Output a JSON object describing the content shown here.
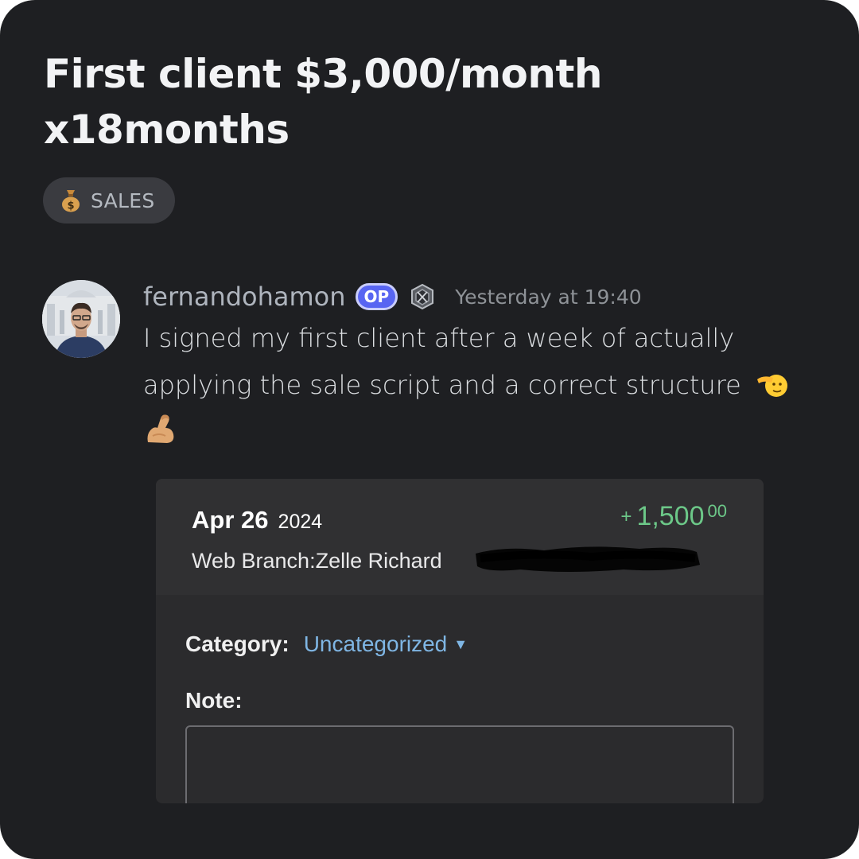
{
  "post": {
    "title": "First client $3,000/month x18months",
    "tag": {
      "icon": "money-bag-icon",
      "label": "SALES"
    }
  },
  "message": {
    "author": "fernandohamon",
    "op_badge": "OP",
    "rank_icon": "shield-rank-icon",
    "timestamp": "Yesterday at 19:40",
    "text": "I signed my first client after a week of actually applying the sale script and a correct structure",
    "emojis": [
      "saluting-face-icon",
      "flexed-biceps-icon"
    ]
  },
  "attachment": {
    "date_main": "Apr 26",
    "date_year": "2024",
    "amount_sign": "+",
    "amount_main": "1,500",
    "amount_cents": "00",
    "description": "Web Branch:Zelle Richard",
    "category_label": "Category:",
    "category_value": "Uncategorized",
    "note_label": "Note:",
    "note_value": ""
  },
  "colors": {
    "background": "#1e1f22",
    "op_badge": "#5865f2",
    "amount_positive": "#6cc788",
    "link_blue": "#7fb6e4"
  }
}
